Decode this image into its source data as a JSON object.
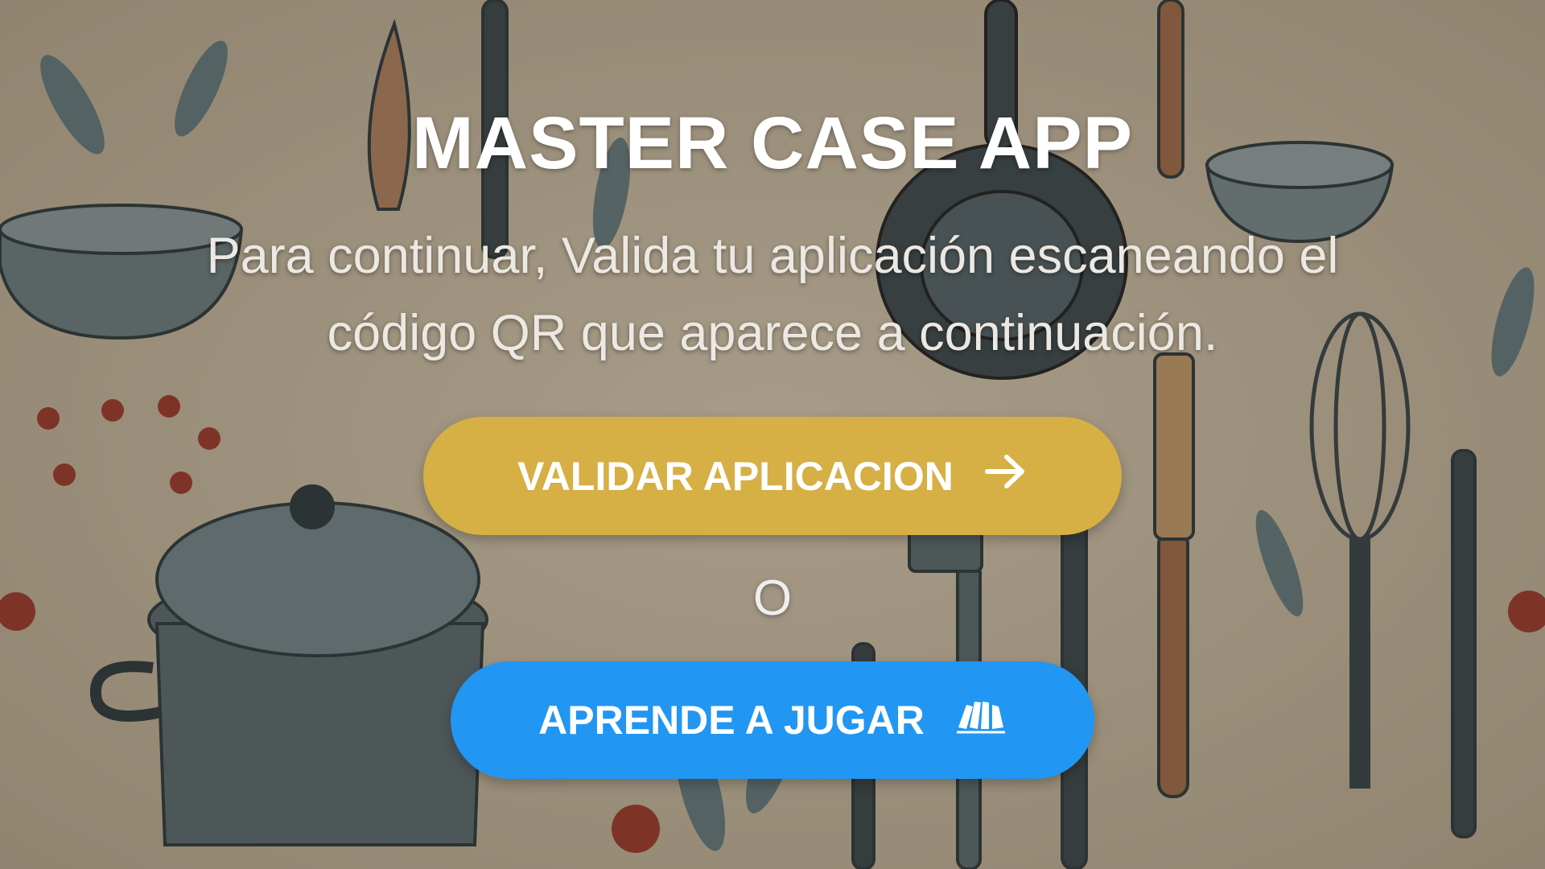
{
  "app": {
    "title": "MASTER CASE APP",
    "subtitle": "Para continuar, Valida tu aplicación escaneando el código QR que aparece a continuación."
  },
  "actions": {
    "validate_label": "VALIDAR APLICACION",
    "validate_icon": "arrow-right-icon",
    "separator": "O",
    "learn_label": "APRENDE A JUGAR",
    "learn_icon": "playing-cards-icon"
  },
  "colors": {
    "validate_button": "#d6af45",
    "learn_button": "#2196f3",
    "title_text": "#ffffff"
  }
}
